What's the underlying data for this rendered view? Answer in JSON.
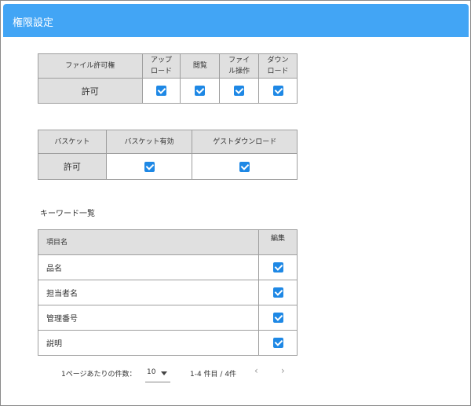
{
  "header": {
    "title": "権限設定"
  },
  "file_permissions": {
    "columns": [
      "ファイル許可権",
      "アップロード",
      "閲覧",
      "ファイル操作",
      "ダウンロード"
    ],
    "column_lines": [
      [
        "ファイル許可権"
      ],
      [
        "アップ",
        "ロード"
      ],
      [
        "閲覧"
      ],
      [
        "ファイ",
        "ル操作"
      ],
      [
        "ダウン",
        "ロード"
      ]
    ],
    "row_label": "許可",
    "checked": [
      true,
      true,
      true,
      true
    ]
  },
  "basket": {
    "columns": [
      "バスケット",
      "バスケット有効",
      "ゲストダウンロード"
    ],
    "row_label": "許可",
    "checked": [
      true,
      true
    ]
  },
  "keywords": {
    "section_title": "キーワード一覧",
    "columns": [
      "項目名",
      "編集"
    ],
    "rows": [
      {
        "name": "品名",
        "checked": true
      },
      {
        "name": "担当者名",
        "checked": true
      },
      {
        "name": "管理番号",
        "checked": true
      },
      {
        "name": "説明",
        "checked": true
      }
    ]
  },
  "pagination": {
    "per_page_label": "1ページあたりの件数：",
    "per_page_value": "10",
    "range_text": "1-4 件目 / 4件",
    "prev_symbol": "‹",
    "next_symbol": "›"
  }
}
